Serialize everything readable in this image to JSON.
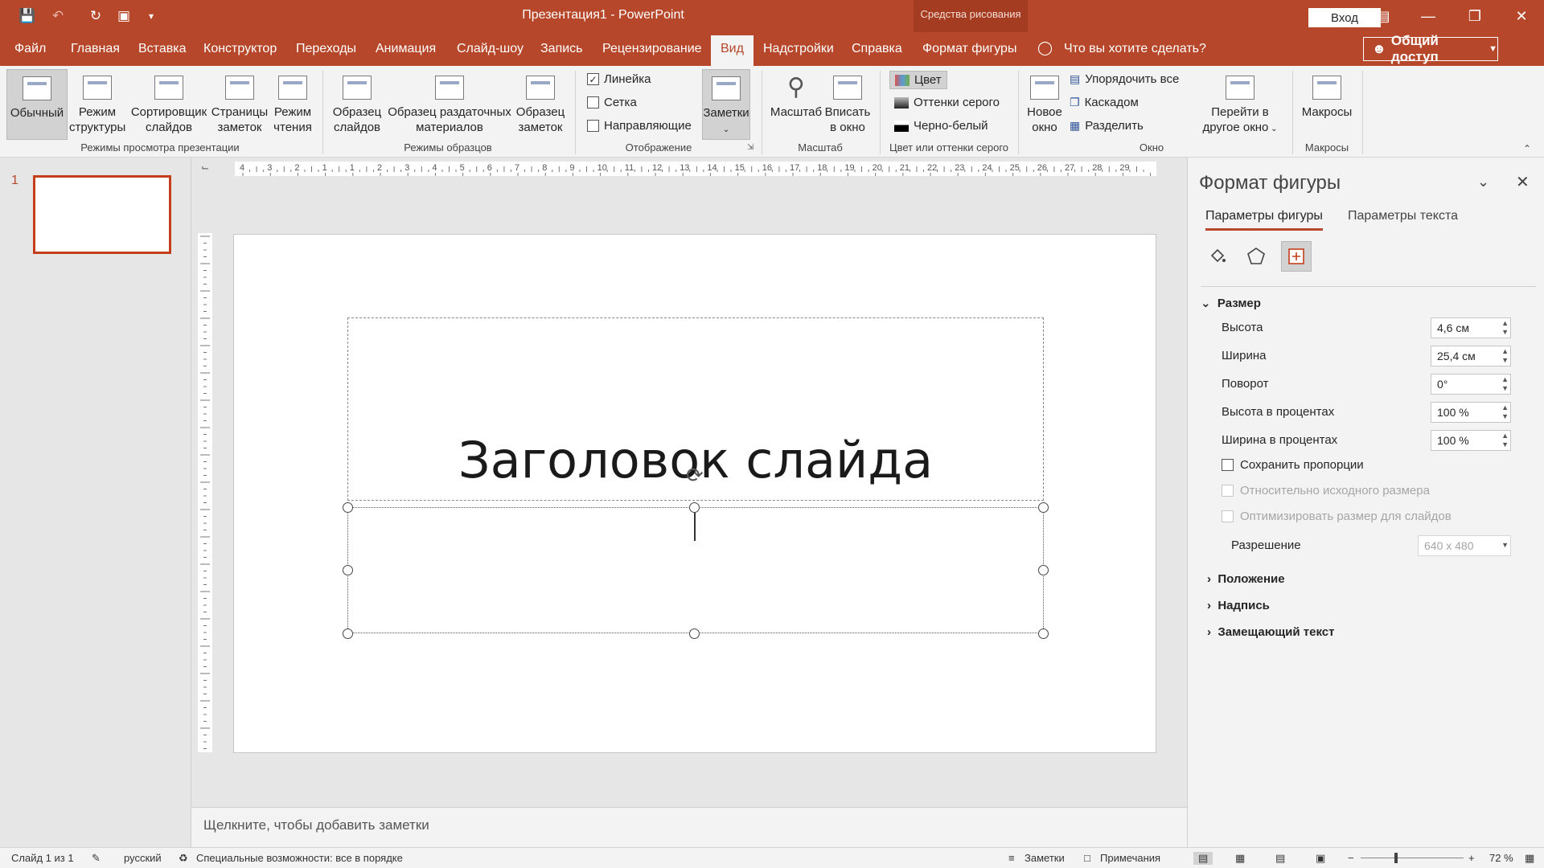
{
  "app": {
    "window_title": "Презентация1 - PowerPoint",
    "contextual_group": "Средства рисования",
    "sign_in": "Вход",
    "share": "Общий доступ",
    "tell_me": "Что вы хотите сделать?",
    "accent_color": "#b7472a"
  },
  "tabs": [
    "Файл",
    "Главная",
    "Вставка",
    "Конструктор",
    "Переходы",
    "Анимация",
    "Слайд-шоу",
    "Запись",
    "Рецензирование",
    "Вид",
    "Надстройки",
    "Справка",
    "Формат фигуры"
  ],
  "active_tab": "Вид",
  "ribbon": {
    "normal": "Обычный",
    "outline_1": "Режим",
    "outline_2": "структуры",
    "sorter_1": "Сортировщик",
    "sorter_2": "слайдов",
    "notes_page_1": "Страницы",
    "notes_page_2": "заметок",
    "reading_1": "Режим",
    "reading_2": "чтения",
    "group_views": "Режимы просмотра презентации",
    "slide_master_1": "Образец",
    "slide_master_2": "слайдов",
    "handout_master_1": "Образец раздаточных",
    "handout_master_2": "материалов",
    "notes_master_1": "Образец",
    "notes_master_2": "заметок",
    "group_masters": "Режимы образцов",
    "ruler": "Линейка",
    "gridlines": "Сетка",
    "guides": "Направляющие",
    "notes_btn": "Заметки",
    "group_show": "Отображение",
    "zoom": "Масштаб",
    "fit_1": "Вписать",
    "fit_2": "в окно",
    "group_zoom": "Масштаб",
    "color": "Цвет",
    "grayscale": "Оттенки серого",
    "bw": "Черно-белый",
    "group_color": "Цвет или оттенки серого",
    "new_window_1": "Новое",
    "new_window_2": "окно",
    "arrange_all": "Упорядочить все",
    "cascade": "Каскадом",
    "split": "Разделить",
    "switch_1": "Перейти в",
    "switch_2": "другое окно",
    "group_window": "Окно",
    "macros": "Макросы",
    "group_macros": "Макросы"
  },
  "thumbs": {
    "number": "1"
  },
  "hruler_labels": [
    "4",
    "3",
    "2",
    "1",
    "1",
    "2",
    "3",
    "4",
    "5",
    "6",
    "7",
    "8",
    "9",
    "10",
    "11",
    "12",
    "13",
    "14",
    "15",
    "16",
    "17",
    "18",
    "19",
    "20",
    "21",
    "22",
    "23",
    "24",
    "25",
    "26",
    "27",
    "28",
    "29"
  ],
  "slide": {
    "title": "Заголовок слайда"
  },
  "notes": {
    "placeholder": "Щелкните, чтобы добавить заметки"
  },
  "format_pane": {
    "title": "Формат фигуры",
    "tab_shape": "Параметры фигуры",
    "tab_text": "Параметры текста",
    "section_size": "Размер",
    "height_label": "Высота",
    "height_value": "4,6 см",
    "width_label": "Ширина",
    "width_value": "25,4 см",
    "rotation_label": "Поворот",
    "rotation_value": "0°",
    "scale_h_label": "Высота в процентах",
    "scale_h_value": "100 %",
    "scale_w_label": "Ширина в процентах",
    "scale_w_value": "100 %",
    "lock_aspect": "Сохранить пропорции",
    "relative_orig": "Относительно исходного размера",
    "best_scale": "Оптимизировать размер для слайдов",
    "resolution_label": "Разрешение",
    "resolution_value": "640 x 480",
    "section_position": "Положение",
    "section_textbox": "Надпись",
    "section_alt": "Замещающий текст"
  },
  "status": {
    "slide_count": "Слайд 1 из 1",
    "language": "русский",
    "accessibility": "Специальные возможности: все в порядке",
    "notes": "Заметки",
    "comments": "Примечания",
    "zoom": "72 %"
  }
}
